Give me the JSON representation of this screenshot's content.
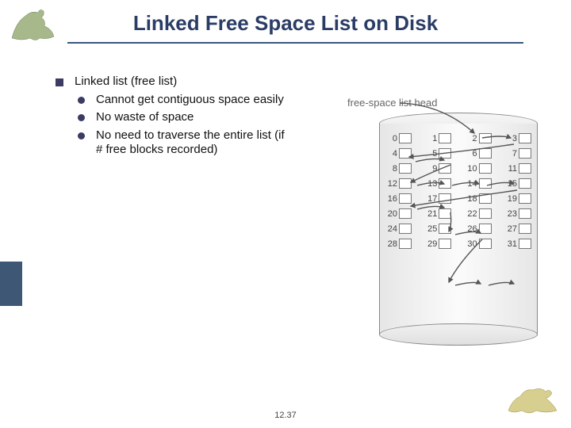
{
  "title": "Linked Free Space List on Disk",
  "page_number": "12.37",
  "bullets": {
    "main": "Linked list (free list)",
    "sub": [
      "Cannot get contiguous space easily",
      "No waste of space",
      "No need to traverse the entire list (if # free blocks recorded)"
    ]
  },
  "figure": {
    "caption": "free-space list head",
    "rows": [
      [
        "0",
        "1",
        "2",
        "3"
      ],
      [
        "4",
        "5",
        "6",
        "7"
      ],
      [
        "8",
        "9",
        "10",
        "11"
      ],
      [
        "12",
        "13",
        "14",
        "15"
      ],
      [
        "16",
        "17",
        "18",
        "19"
      ],
      [
        "20",
        "21",
        "22",
        "23"
      ],
      [
        "24",
        "25",
        "26",
        "27"
      ],
      [
        "28",
        "29",
        "30",
        "31"
      ]
    ],
    "linked_sequence": [
      "head",
      "2",
      "3",
      "4",
      "5",
      "8",
      "9",
      "10",
      "11",
      "12",
      "13",
      "17",
      "18",
      "25",
      "26",
      "27"
    ]
  }
}
